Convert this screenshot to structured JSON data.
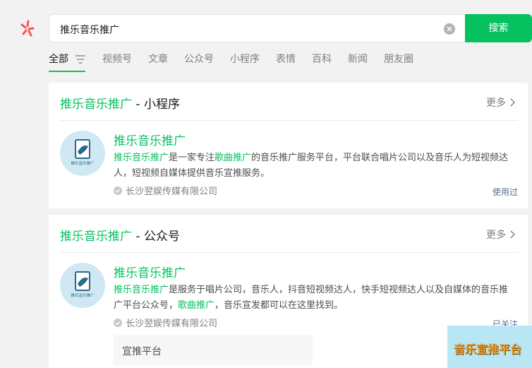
{
  "search": {
    "query": "推乐音乐推广",
    "button_label": "搜索"
  },
  "tabs": [
    {
      "label": "全部",
      "active": true
    },
    {
      "label": "视频号"
    },
    {
      "label": "文章"
    },
    {
      "label": "公众号"
    },
    {
      "label": "小程序"
    },
    {
      "label": "表情"
    },
    {
      "label": "百科"
    },
    {
      "label": "新闻"
    },
    {
      "label": "朋友圈"
    }
  ],
  "cards": [
    {
      "title_keyword": "推乐音乐推广",
      "title_suffix": " - 小程序",
      "more_label": "更多",
      "entry": {
        "name": "推乐音乐推广",
        "desc_parts": [
          "推乐音乐推广",
          "是一家专注",
          "歌曲推广",
          "的音乐推广服务平台，平台联合唱片公司以及音乐人为短视频达人，短视频自媒体提供音乐宣推服务。"
        ],
        "owner": "长沙翌娱传媒有限公司",
        "status": "使用过"
      }
    },
    {
      "title_keyword": "推乐音乐推广",
      "title_suffix": " - 公众号",
      "more_label": "更多",
      "entry": {
        "name": "推乐音乐推广",
        "desc_parts": [
          "推乐音乐推广",
          "是服务于唱片公司，音乐人，抖音短视频达人，快手短视频达人以及自媒体的音乐推广平台公众号，",
          "歌曲推广",
          "，音乐宣发都可以在这里找到。"
        ],
        "owner": "长沙翌娱传媒有限公司",
        "status": "已关注",
        "related": "宣推平台"
      }
    }
  ],
  "avatar_text": "推乐音乐推广",
  "watermark": "音乐宣推平台",
  "colors": {
    "accent": "#07c160",
    "link": "#576b95",
    "background": "#f2f2f2"
  }
}
